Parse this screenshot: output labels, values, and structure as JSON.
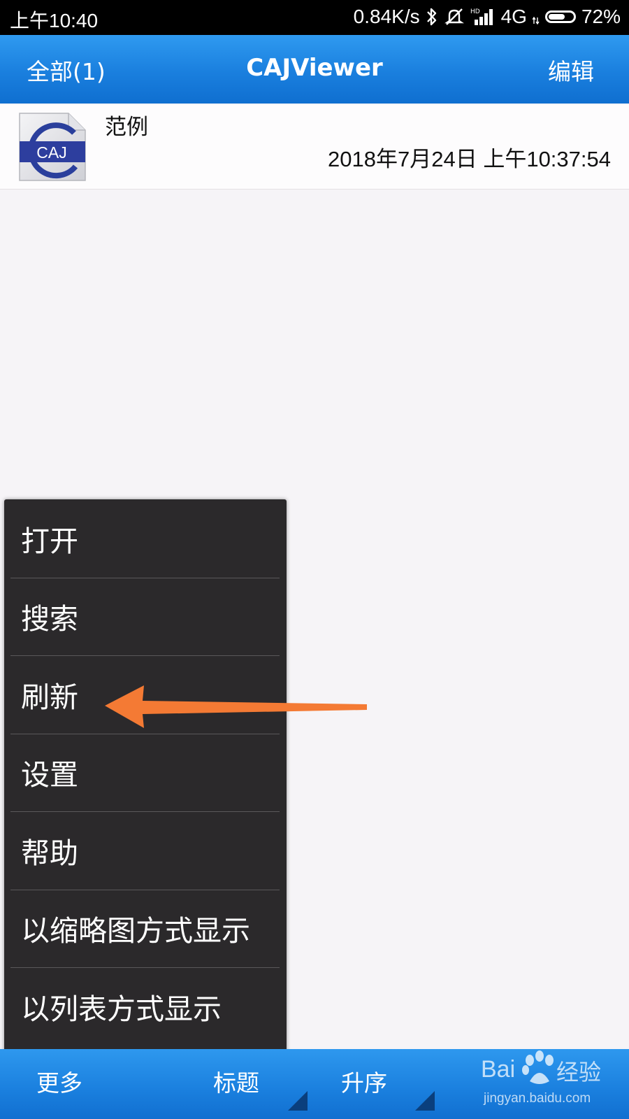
{
  "status_bar": {
    "time": "上午10:40",
    "network_speed": "0.84K/s",
    "network_type": "4G",
    "battery_percent": "72%",
    "battery_level": 0.72
  },
  "app_bar": {
    "left_label": "全部(1)",
    "title": "CAJViewer",
    "right_label": "编辑"
  },
  "files": [
    {
      "icon": "caj-file-icon",
      "icon_text": "CAJ",
      "name": "范例",
      "date": "2018年7月24日 上午10:37:54"
    }
  ],
  "menu": {
    "items": [
      {
        "label": "打开"
      },
      {
        "label": "搜索"
      },
      {
        "label": "刷新"
      },
      {
        "label": "设置"
      },
      {
        "label": "帮助"
      },
      {
        "label": "以缩略图方式显示"
      },
      {
        "label": "以列表方式显示"
      }
    ]
  },
  "annotation": {
    "type": "arrow",
    "color": "#f47a34",
    "points_to": "刷新"
  },
  "bottom_bar": {
    "more_label": "更多",
    "sort_field_label": "标题",
    "sort_order_label": "升序"
  },
  "watermark": {
    "brand_text": "Bai",
    "experience_text": "经验",
    "url": "jingyan.baidu.com"
  },
  "colors": {
    "app_bar_blue": "#1a7fde",
    "menu_background": "#2b292b",
    "page_background": "#f6f4f7",
    "arrow_orange": "#f47a34"
  }
}
